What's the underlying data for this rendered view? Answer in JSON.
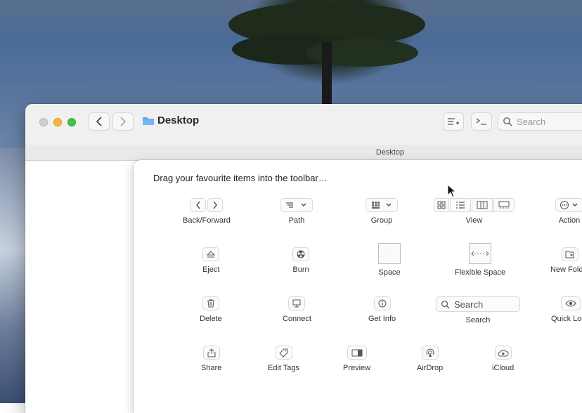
{
  "window": {
    "title": "Desktop",
    "path_title": "Desktop",
    "search_placeholder": "Search"
  },
  "sheet": {
    "header": "Drag your favourite items into the toolbar…",
    "items": [
      {
        "label": "Back/Forward",
        "icon": "back-forward-icon"
      },
      {
        "label": "Path",
        "icon": "path-icon"
      },
      {
        "label": "Group",
        "icon": "group-icon"
      },
      {
        "label": "View",
        "icon": "view-icon"
      },
      {
        "label": "Action",
        "icon": "action-icon"
      },
      {
        "label": "Eject",
        "icon": "eject-icon"
      },
      {
        "label": "Burn",
        "icon": "burn-icon"
      },
      {
        "label": "Space",
        "icon": "space-icon"
      },
      {
        "label": "Flexible Space",
        "icon": "flexible-space-icon"
      },
      {
        "label": "New Folder",
        "icon": "new-folder-icon"
      },
      {
        "label": "Delete",
        "icon": "trash-icon"
      },
      {
        "label": "Connect",
        "icon": "connect-icon"
      },
      {
        "label": "Get Info",
        "icon": "info-icon"
      },
      {
        "label": "Search",
        "icon": "search-icon",
        "placeholder": "Search"
      },
      {
        "label": "Quick Look",
        "icon": "eye-icon"
      },
      {
        "label": "Share",
        "icon": "share-icon"
      },
      {
        "label": "Edit Tags",
        "icon": "tag-icon"
      },
      {
        "label": "Preview",
        "icon": "preview-icon"
      },
      {
        "label": "AirDrop",
        "icon": "airdrop-icon"
      },
      {
        "label": "iCloud",
        "icon": "icloud-icon"
      }
    ]
  }
}
